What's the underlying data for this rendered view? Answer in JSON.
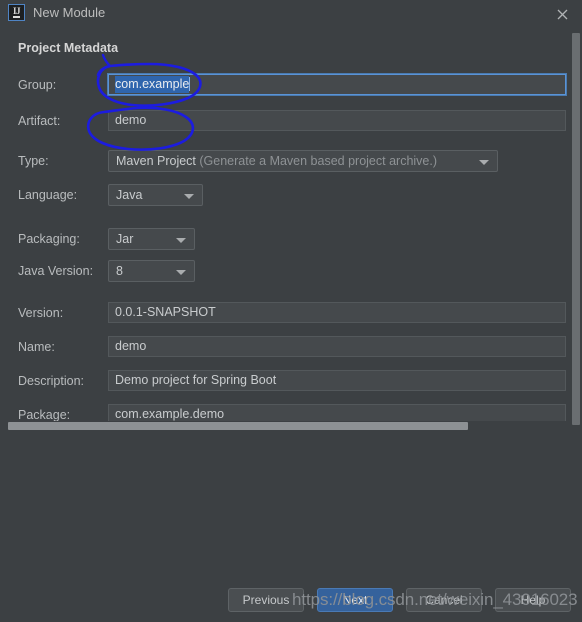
{
  "window": {
    "title": "New Module",
    "app_icon": "intellij-ij-icon",
    "close_icon": "close-icon"
  },
  "section": {
    "title": "Project Metadata"
  },
  "form": {
    "fields": [
      {
        "label": "Group:",
        "value": "com.example",
        "type": "text",
        "focused": true,
        "selected": true
      },
      {
        "label": "Artifact:",
        "value": "demo",
        "type": "text",
        "focused": false,
        "selected": false
      },
      {
        "label": "Type:",
        "value": "Maven Project",
        "hint": "(Generate a Maven based project archive.)",
        "type": "combo"
      },
      {
        "label": "Language:",
        "value": "Java",
        "type": "combo"
      },
      {
        "label": "Packaging:",
        "value": "Jar",
        "type": "combo"
      },
      {
        "label": "Java Version:",
        "value": "8",
        "type": "combo"
      },
      {
        "label": "Version:",
        "value": "0.0.1-SNAPSHOT",
        "type": "text",
        "focused": false,
        "selected": false
      },
      {
        "label": "Name:",
        "value": "demo",
        "type": "text",
        "focused": false,
        "selected": false
      },
      {
        "label": "Description:",
        "value": "Demo project for Spring Boot",
        "type": "text",
        "focused": false,
        "selected": false
      },
      {
        "label": "Package:",
        "value": "com.example.demo",
        "type": "text",
        "focused": false,
        "selected": false
      }
    ]
  },
  "buttons": {
    "previous": "Previous",
    "next": "Next",
    "cancel": "Cancel",
    "help": "Help"
  },
  "watermark": {
    "text": "https://blog.csdn.net/weixin_43916023"
  },
  "annotations": {
    "circles": [
      {
        "target": "group-field",
        "color": "#1c1ce0"
      },
      {
        "target": "artifact-field",
        "color": "#1c1ce0"
      }
    ]
  },
  "colors": {
    "background": "#3c4043",
    "field_background": "#45494c",
    "accent_focus": "#5a93d6",
    "selection": "#2f65ad",
    "primary_button": "#35629c",
    "annotation": "#1c1ce0"
  }
}
